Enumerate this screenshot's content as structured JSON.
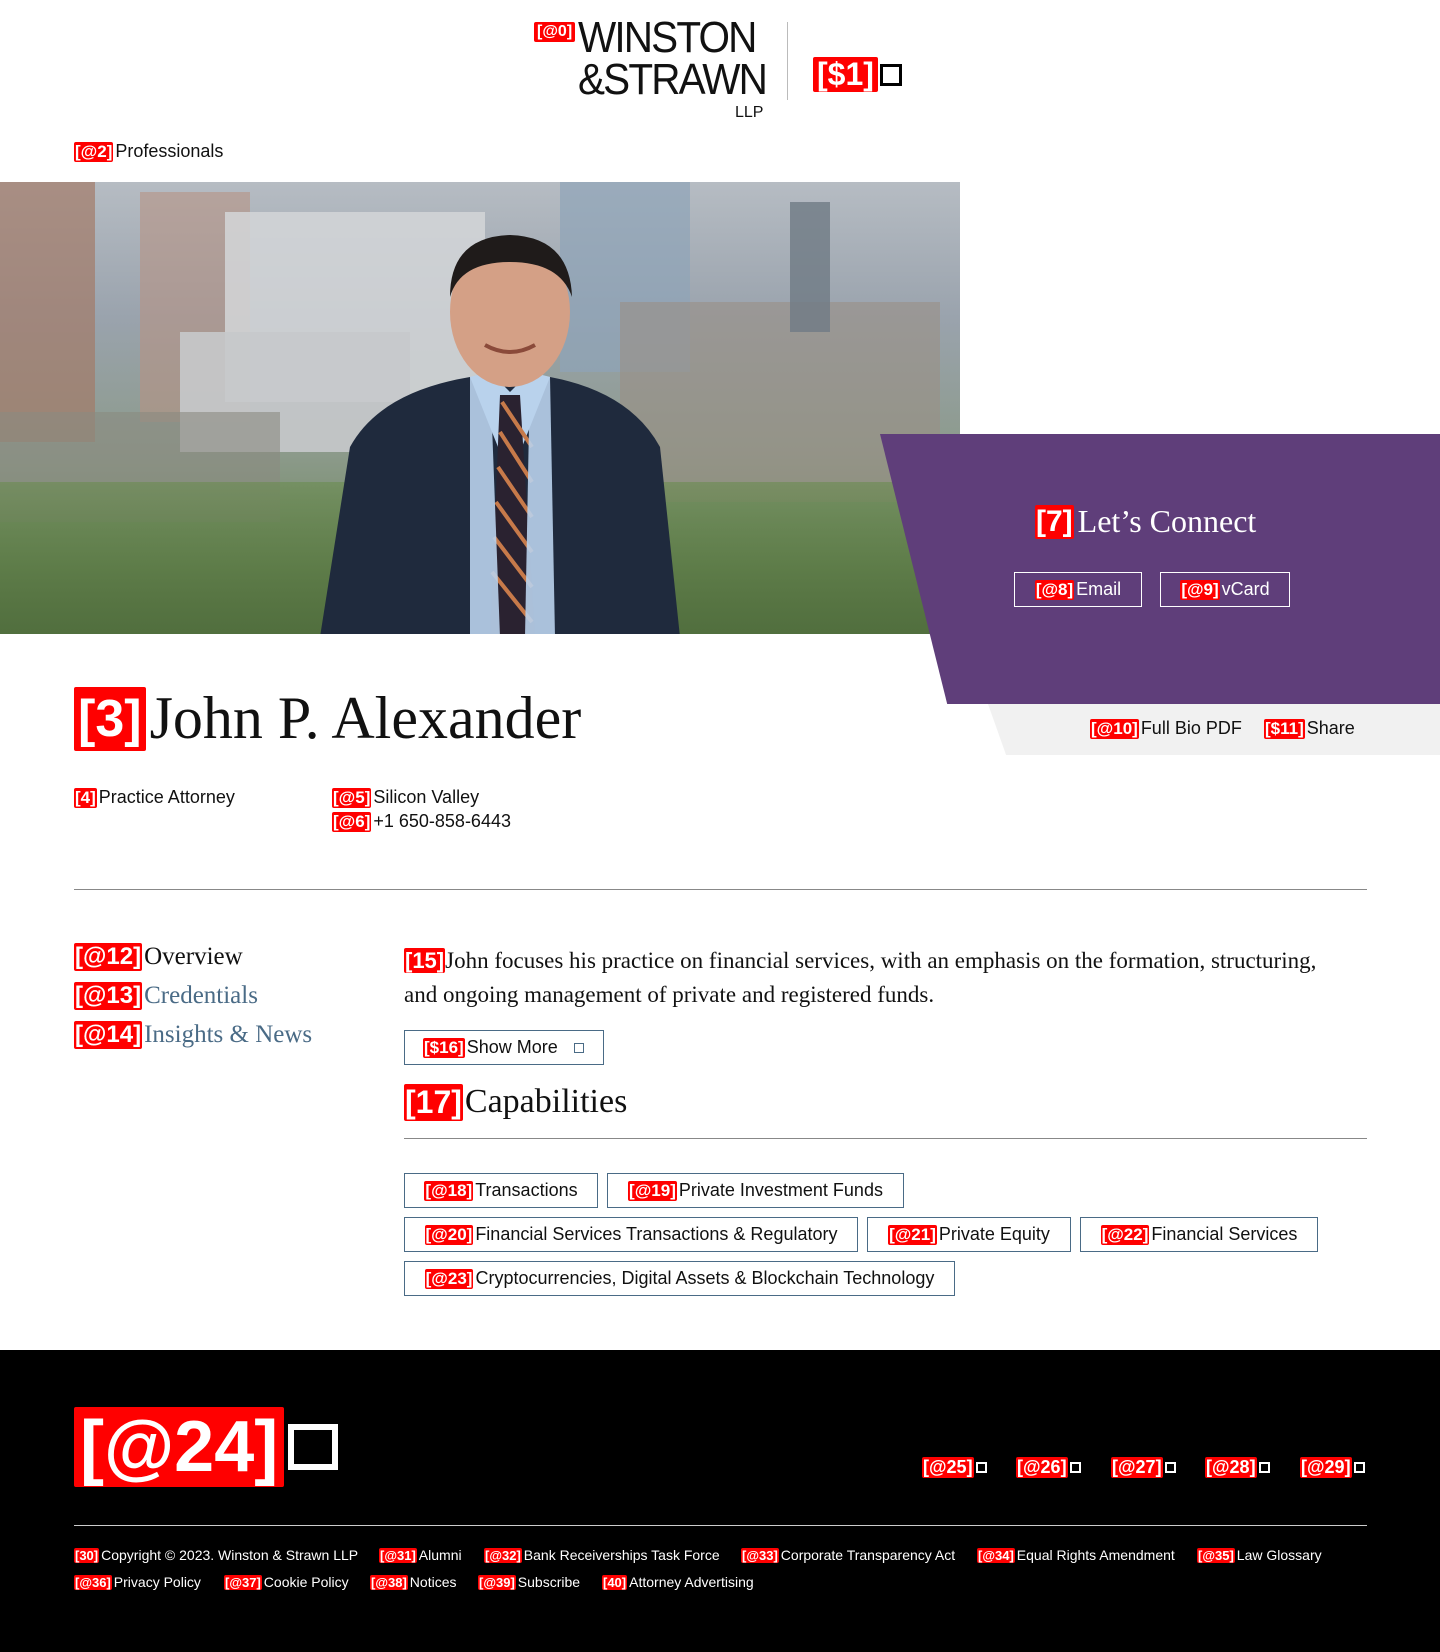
{
  "header": {
    "logo_tag": "[@0]",
    "logo_line1": "WINSTON",
    "logo_line2": "&STRAWN",
    "logo_line3": "LLP",
    "menu_tag": "[$1]",
    "menu_icon": "menu-icon"
  },
  "breadcrumb": {
    "tag": "[@2]",
    "label": "Professionals"
  },
  "profile": {
    "name_tag": "[3]",
    "name": "John P. Alexander",
    "title_tag": "[4]",
    "title": "Practice Attorney",
    "office_tag": "[@5]",
    "office": "Silicon Valley",
    "phone_tag": "[@6]",
    "phone": "+1 650-858-6443"
  },
  "connect": {
    "heading_tag": "[7]",
    "heading": "Let’s Connect",
    "email_tag": "[@8]",
    "email": "Email",
    "vcard_tag": "[@9]",
    "vcard": "vCard",
    "accent": "#5f3e7a"
  },
  "utilities": {
    "pdf_tag": "[@10]",
    "pdf": "Full Bio PDF",
    "share_tag": "[$11]",
    "share": "Share"
  },
  "sidenav": [
    {
      "tag": "[@12]",
      "label": "Overview",
      "active": true
    },
    {
      "tag": "[@13]",
      "label": "Credentials",
      "active": false
    },
    {
      "tag": "[@14]",
      "label": "Insights & News",
      "active": false
    }
  ],
  "overview": {
    "tag": "[15]",
    "text": "John focuses his practice on financial services, with an emphasis on the formation, structuring, and ongoing management of private and registered funds.",
    "show_more_tag": "[$16]",
    "show_more": "Show More"
  },
  "capabilities": {
    "tag": "[17]",
    "title": "Capabilities",
    "items": [
      {
        "tag": "[@18]",
        "label": "Transactions"
      },
      {
        "tag": "[@19]",
        "label": "Private Investment Funds"
      },
      {
        "tag": "[@20]",
        "label": "Financial Services Transactions & Regulatory"
      },
      {
        "tag": "[@21]",
        "label": "Private Equity"
      },
      {
        "tag": "[@22]",
        "label": "Financial Services"
      },
      {
        "tag": "[@23]",
        "label": "Cryptocurrencies, Digital Assets & Blockchain Technology"
      }
    ]
  },
  "footer": {
    "logo_tag": "[@24]",
    "social": [
      {
        "tag": "[@25]",
        "icon": "social-icon"
      },
      {
        "tag": "[@26]",
        "icon": "social-icon"
      },
      {
        "tag": "[@27]",
        "icon": "social-icon"
      },
      {
        "tag": "[@28]",
        "icon": "social-icon"
      },
      {
        "tag": "[@29]",
        "icon": "social-icon"
      }
    ],
    "links": [
      {
        "tag": "[30]",
        "label": "Copyright © 2023. Winston & Strawn LLP"
      },
      {
        "tag": "[@31]",
        "label": "Alumni"
      },
      {
        "tag": "[@32]",
        "label": "Bank Receiverships Task Force"
      },
      {
        "tag": "[@33]",
        "label": "Corporate Transparency Act"
      },
      {
        "tag": "[@34]",
        "label": "Equal Rights Amendment"
      },
      {
        "tag": "[@35]",
        "label": "Law Glossary"
      },
      {
        "tag": "[@36]",
        "label": "Privacy Policy"
      },
      {
        "tag": "[@37]",
        "label": "Cookie Policy"
      },
      {
        "tag": "[@38]",
        "label": "Notices"
      },
      {
        "tag": "[@39]",
        "label": "Subscribe"
      },
      {
        "tag": "[40]",
        "label": "Attorney Advertising"
      }
    ]
  }
}
